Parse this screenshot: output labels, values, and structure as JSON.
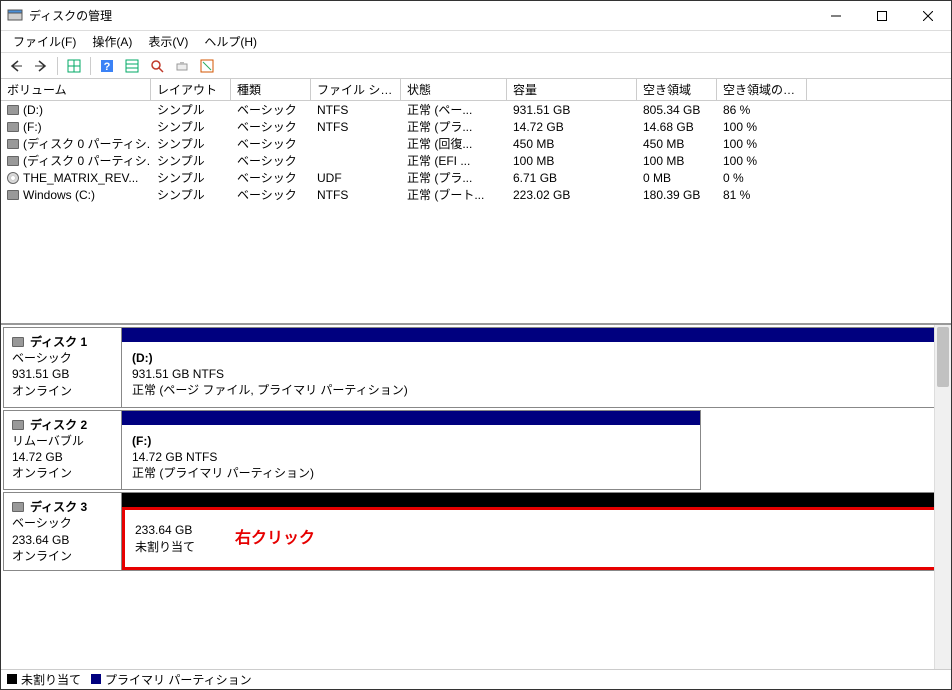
{
  "window": {
    "title": "ディスクの管理"
  },
  "menu": {
    "file": "ファイル(F)",
    "action": "操作(A)",
    "view": "表示(V)",
    "help": "ヘルプ(H)"
  },
  "columns": [
    "ボリューム",
    "レイアウト",
    "種類",
    "ファイル システム",
    "状態",
    "容量",
    "空き領域",
    "空き領域の割..."
  ],
  "rows": [
    {
      "icon": "drive",
      "name": "(D:)",
      "layout": "シンプル",
      "type": "ベーシック",
      "fs": "NTFS",
      "status": "正常 (ペー...",
      "size": "931.51 GB",
      "free": "805.34 GB",
      "pct": "86 %"
    },
    {
      "icon": "drive",
      "name": "(F:)",
      "layout": "シンプル",
      "type": "ベーシック",
      "fs": "NTFS",
      "status": "正常 (プラ...",
      "size": "14.72 GB",
      "free": "14.68 GB",
      "pct": "100 %"
    },
    {
      "icon": "drive",
      "name": "(ディスク 0 パーティシ...",
      "layout": "シンプル",
      "type": "ベーシック",
      "fs": "",
      "status": "正常 (回復...",
      "size": "450 MB",
      "free": "450 MB",
      "pct": "100 %"
    },
    {
      "icon": "drive",
      "name": "(ディスク 0 パーティシ...",
      "layout": "シンプル",
      "type": "ベーシック",
      "fs": "",
      "status": "正常 (EFI ...",
      "size": "100 MB",
      "free": "100 MB",
      "pct": "100 %"
    },
    {
      "icon": "dvd",
      "name": "THE_MATRIX_REV...",
      "layout": "シンプル",
      "type": "ベーシック",
      "fs": "UDF",
      "status": "正常 (プラ...",
      "size": "6.71 GB",
      "free": "0 MB",
      "pct": "0 %"
    },
    {
      "icon": "drive",
      "name": "Windows (C:)",
      "layout": "シンプル",
      "type": "ベーシック",
      "fs": "NTFS",
      "status": "正常 (ブート...",
      "size": "223.02 GB",
      "free": "180.39 GB",
      "pct": "81 %"
    }
  ],
  "disks": {
    "d1": {
      "name": "ディスク 1",
      "type": "ベーシック",
      "size": "931.51 GB",
      "status": "オンライン",
      "part": {
        "title": "(D:)",
        "sub": "931.51 GB NTFS",
        "state": "正常 (ページ ファイル, プライマリ パーティション)"
      }
    },
    "d2": {
      "name": "ディスク 2",
      "type": "リムーバブル",
      "size": "14.72 GB",
      "status": "オンライン",
      "part": {
        "title": "(F:)",
        "sub": "14.72 GB NTFS",
        "state": "正常 (プライマリ パーティション)"
      }
    },
    "d3": {
      "name": "ディスク 3",
      "type": "ベーシック",
      "size": "233.64 GB",
      "status": "オンライン",
      "part": {
        "title": "",
        "sub": "233.64 GB",
        "state": "未割り当て"
      }
    }
  },
  "annotation": "右クリック",
  "legend": {
    "unalloc": "未割り当て",
    "primary": "プライマリ パーティション"
  }
}
